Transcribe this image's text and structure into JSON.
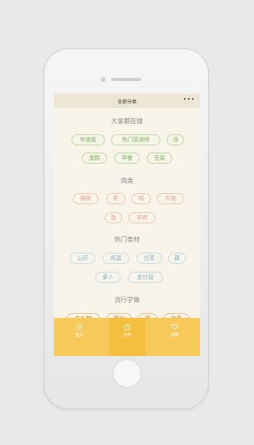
{
  "nav": {
    "title": "全部分类",
    "more": "•••"
  },
  "sections": [
    {
      "title": "大家都在搜",
      "tags": [
        "年夜饭",
        "热门菜谱榜",
        "汤",
        "蛋糕",
        "早餐",
        "豆腐"
      ]
    },
    {
      "title": "肉类",
      "tags": [
        "排骨",
        "虾",
        "鸡",
        "牛肉",
        "鱼",
        "羊肉"
      ]
    },
    {
      "title": "热门食材",
      "tags": [
        "山药",
        "鸡蛋",
        "白菜",
        "藕",
        "萝卜",
        "金针菇"
      ]
    },
    {
      "title": "流行学做",
      "tags": [
        "牛轧糖",
        "蛋挞",
        "粥",
        "凉菜"
      ]
    }
  ],
  "tabs": [
    {
      "label": "首页",
      "icon": "home-icon"
    },
    {
      "label": "分类",
      "icon": "pot-icon"
    },
    {
      "label": "收藏",
      "icon": "heart-icon"
    }
  ],
  "colors": {
    "background": "#f8f4ea",
    "tabbar": "#f7c95a",
    "green": "#7db563",
    "pink": "#e59b80",
    "blue": "#87b5cf",
    "orange": "#c98c3a"
  }
}
